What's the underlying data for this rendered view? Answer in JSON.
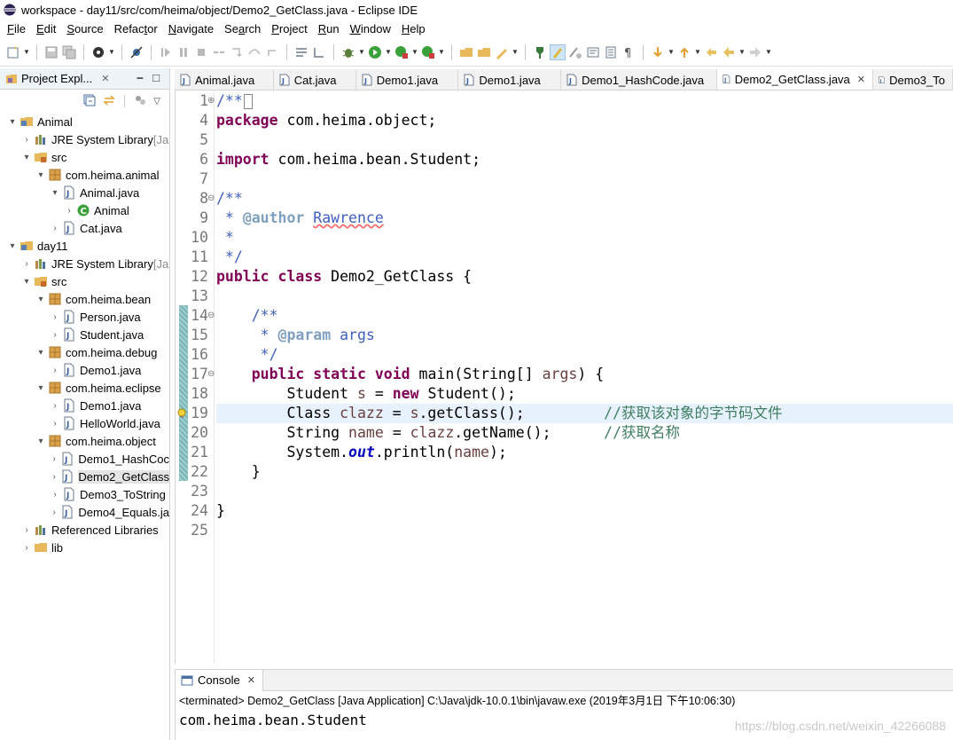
{
  "window": {
    "title": "workspace - day11/src/com/heima/object/Demo2_GetClass.java - Eclipse IDE"
  },
  "menu": [
    {
      "u": "F",
      "rest": "ile"
    },
    {
      "u": "E",
      "rest": "dit"
    },
    {
      "u": "S",
      "rest": "ource"
    },
    {
      "u": "",
      "rest": "Refac",
      "u2": "t",
      "rest2": "or"
    },
    {
      "u": "N",
      "rest": "avigate"
    },
    {
      "u": "",
      "rest": "Se",
      "u2": "a",
      "rest2": "rch"
    },
    {
      "u": "P",
      "rest": "roject"
    },
    {
      "u": "R",
      "rest": "un"
    },
    {
      "u": "W",
      "rest": "indow"
    },
    {
      "u": "H",
      "rest": "elp"
    }
  ],
  "explorer": {
    "title": "Project Expl...",
    "close": "✕",
    "tree": [
      {
        "depth": 0,
        "arrow": "▾",
        "icon": "project-icon",
        "label": "Animal"
      },
      {
        "depth": 1,
        "arrow": "›",
        "icon": "library-icon",
        "label": "JRE System Library",
        "suffix": " [Ja"
      },
      {
        "depth": 1,
        "arrow": "▾",
        "icon": "src-folder-icon",
        "label": "src"
      },
      {
        "depth": 2,
        "arrow": "▾",
        "icon": "package-icon",
        "label": "com.heima.animal"
      },
      {
        "depth": 3,
        "arrow": "▾",
        "icon": "java-file-icon",
        "label": "Animal.java"
      },
      {
        "depth": 4,
        "arrow": "›",
        "icon": "class-icon",
        "label": "Animal"
      },
      {
        "depth": 3,
        "arrow": "›",
        "icon": "java-file-icon",
        "label": "Cat.java"
      },
      {
        "depth": 0,
        "arrow": "▾",
        "icon": "project-icon",
        "label": "day11"
      },
      {
        "depth": 1,
        "arrow": "›",
        "icon": "library-icon",
        "label": "JRE System Library",
        "suffix": " [Ja"
      },
      {
        "depth": 1,
        "arrow": "▾",
        "icon": "src-folder-icon",
        "label": "src"
      },
      {
        "depth": 2,
        "arrow": "▾",
        "icon": "package-icon",
        "label": "com.heima.bean"
      },
      {
        "depth": 3,
        "arrow": "›",
        "icon": "java-file-icon",
        "label": "Person.java"
      },
      {
        "depth": 3,
        "arrow": "›",
        "icon": "java-file-icon",
        "label": "Student.java"
      },
      {
        "depth": 2,
        "arrow": "▾",
        "icon": "package-icon",
        "label": "com.heima.debug"
      },
      {
        "depth": 3,
        "arrow": "›",
        "icon": "java-file-icon",
        "label": "Demo1.java"
      },
      {
        "depth": 2,
        "arrow": "▾",
        "icon": "package-icon",
        "label": "com.heima.eclipse"
      },
      {
        "depth": 3,
        "arrow": "›",
        "icon": "java-file-icon",
        "label": "Demo1.java"
      },
      {
        "depth": 3,
        "arrow": "›",
        "icon": "java-file-icon",
        "label": "HelloWorld.java"
      },
      {
        "depth": 2,
        "arrow": "▾",
        "icon": "package-icon",
        "label": "com.heima.object"
      },
      {
        "depth": 3,
        "arrow": "›",
        "icon": "java-file-icon",
        "label": "Demo1_HashCoc"
      },
      {
        "depth": 3,
        "arrow": "›",
        "icon": "java-file-icon",
        "label": "Demo2_GetClass",
        "selected": true
      },
      {
        "depth": 3,
        "arrow": "›",
        "icon": "java-file-icon",
        "label": "Demo3_ToString"
      },
      {
        "depth": 3,
        "arrow": "›",
        "icon": "java-file-icon",
        "label": "Demo4_Equals.ja"
      },
      {
        "depth": 1,
        "arrow": "›",
        "icon": "library-icon",
        "label": "Referenced Libraries"
      },
      {
        "depth": 1,
        "arrow": "›",
        "icon": "folder-icon",
        "label": "lib"
      }
    ]
  },
  "tabs": [
    {
      "label": "Animal.java",
      "width": 113
    },
    {
      "label": "Cat.java",
      "width": 94
    },
    {
      "label": "Demo1.java",
      "width": 117
    },
    {
      "label": "Demo1.java",
      "width": 117
    },
    {
      "label": "Demo1_HashCode.java",
      "width": 178
    },
    {
      "label": "Demo2_GetClass.java",
      "width": 176,
      "active": true,
      "close": "✕"
    },
    {
      "label": "Demo3_To",
      "width": 90
    }
  ],
  "code": {
    "lines": [
      {
        "n": "1",
        "fold": "⊕",
        "html": "<span class=\"jdoc\">/**</span><span class=\"cursor-box\"></span>"
      },
      {
        "n": "4",
        "html": "<span class=\"kw\">package</span> com.heima.object;"
      },
      {
        "n": "5",
        "html": ""
      },
      {
        "n": "6",
        "html": "<span class=\"kw\">import</span> com.heima.bean.Student;"
      },
      {
        "n": "7",
        "html": ""
      },
      {
        "n": "8",
        "fold": "⊖",
        "html": "<span class=\"jdoc\">/**</span>"
      },
      {
        "n": "9",
        "html": "<span class=\"jdoc\"> * </span><span class=\"jtag\">@author</span><span class=\"jdoc\"> <span class=\"squig\">Rawrence</span></span>"
      },
      {
        "n": "10",
        "html": "<span class=\"jdoc\"> *</span>"
      },
      {
        "n": "11",
        "html": "<span class=\"jdoc\"> */</span>"
      },
      {
        "n": "12",
        "html": "<span class=\"kw\">public</span> <span class=\"kw\">class</span> Demo2_GetClass {"
      },
      {
        "n": "13",
        "html": ""
      },
      {
        "n": "14",
        "fold": "⊖",
        "html": "    <span class=\"jdoc\">/**</span>"
      },
      {
        "n": "15",
        "html": "<span class=\"jdoc\">     * </span><span class=\"jtag\">@param</span><span class=\"jdoc\"> args</span>"
      },
      {
        "n": "16",
        "html": "<span class=\"jdoc\">     */</span>"
      },
      {
        "n": "17",
        "fold": "⊖",
        "html": "    <span class=\"kw\">public</span> <span class=\"kw\">static</span> <span class=\"kw\">void</span> main(String[] <span class=\"var\">args</span>) {"
      },
      {
        "n": "18",
        "html": "        Student <span class=\"var\">s</span> = <span class=\"kw\">new</span> Student();"
      },
      {
        "n": "19",
        "current": true,
        "html": "        Class <span class=\"var\">clazz</span> = <span class=\"var\">s</span>.getClass();         <span class=\"cmt\">//获取该对象的字节码文件</span>"
      },
      {
        "n": "20",
        "html": "        String <span class=\"var\">name</span> = <span class=\"var\">clazz</span>.getName();      <span class=\"cmt\">//获取名称</span>"
      },
      {
        "n": "21",
        "html": "        System.<span class=\"fld\">out</span>.println(<span class=\"var\">name</span>);"
      },
      {
        "n": "22",
        "html": "    }"
      },
      {
        "n": "23",
        "html": ""
      },
      {
        "n": "24",
        "html": "}"
      },
      {
        "n": "25",
        "html": ""
      }
    ]
  },
  "console": {
    "tab_label": "Console",
    "close": "✕",
    "status": "<terminated> Demo2_GetClass [Java Application] C:\\Java\\jdk-10.0.1\\bin\\javaw.exe (2019年3月1日 下午10:06:30)",
    "output": "com.heima.bean.Student",
    "watermark": "https://blog.csdn.net/weixin_42266088"
  }
}
